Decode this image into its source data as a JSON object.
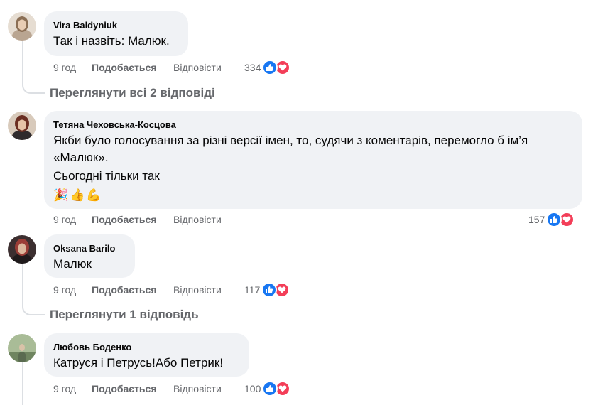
{
  "comments": [
    {
      "author": "Vira Baldyniuk",
      "lines": [
        "Так і назвіть: Малюк."
      ],
      "time": "9 год",
      "like_label": "Подобається",
      "reply_label": "Відповісти",
      "reaction_count": "334",
      "view_replies": "Переглянути всі 2 відповіді",
      "avatar_colors": [
        "#d9cfc1",
        "#6d5a47"
      ]
    },
    {
      "author": "Тетяна Чеховська-Косцова",
      "lines": [
        "Якби було голосування за різні версії імен, то, судячи з коментарів, перемогло б ім’я",
        "«Малюк».",
        "Сьогодні тільки так"
      ],
      "emojis": "🎉👍💪",
      "time": "9 год",
      "like_label": "Подобається",
      "reply_label": "Відповісти",
      "reaction_count": "157",
      "avatar_colors": [
        "#c9b9a8",
        "#7a3b2e"
      ]
    },
    {
      "author": "Oksana Barilo",
      "lines": [
        "Малюк"
      ],
      "time": "9 год",
      "like_label": "Подобається",
      "reply_label": "Відповісти",
      "reaction_count": "117",
      "view_replies": "Переглянути 1 відповідь",
      "avatar_colors": [
        "#3b2a2a",
        "#a0463d"
      ]
    },
    {
      "author": "Любовь Боденко",
      "lines": [
        "Катруся і Петрусь!Або Петрик!"
      ],
      "time": "9 год",
      "like_label": "Подобається",
      "reply_label": "Відповісти",
      "reaction_count": "100",
      "avatar_colors": [
        "#8aa37a",
        "#4d5f45"
      ]
    }
  ],
  "colors": {
    "bubble": "#f0f2f5",
    "secondary_text": "#65676b",
    "like_blue": "#1877f2",
    "love_red": "#f33e58"
  },
  "icons": [
    "like-reaction-icon",
    "love-reaction-icon"
  ]
}
